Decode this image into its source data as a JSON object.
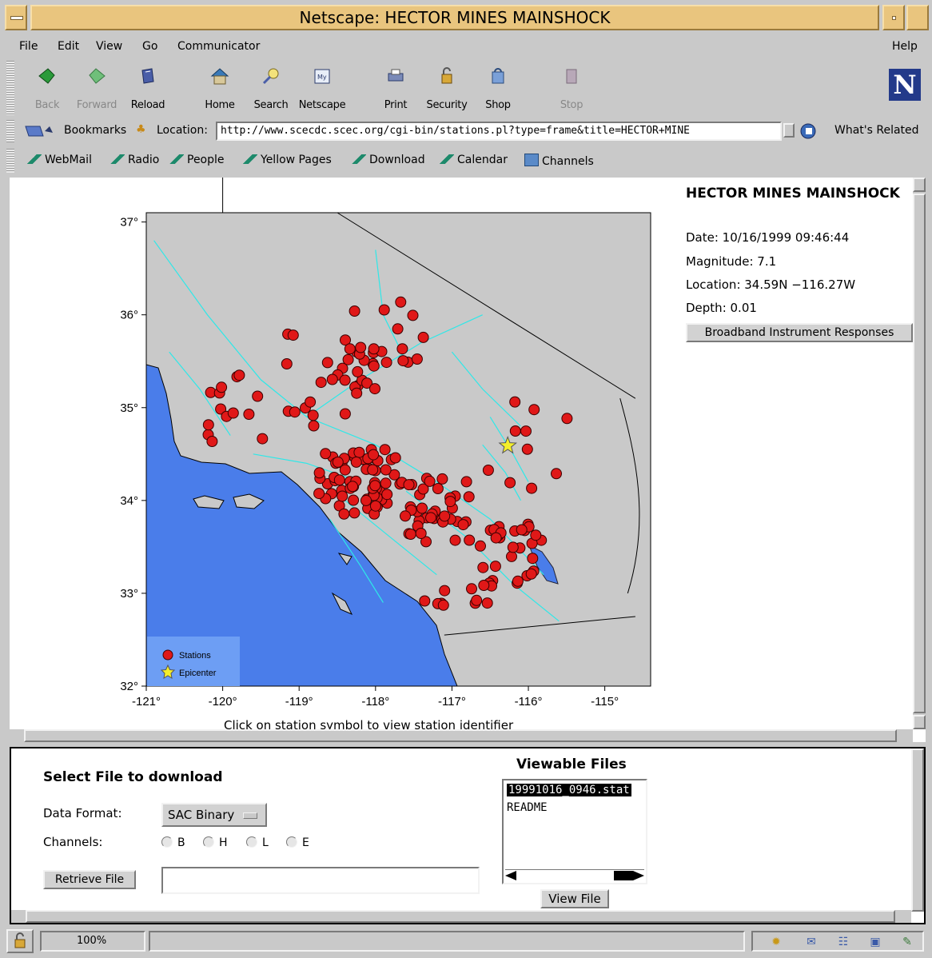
{
  "window": {
    "title": "Netscape: HECTOR MINES MAINSHOCK"
  },
  "menu": {
    "file": "File",
    "edit": "Edit",
    "view": "View",
    "go": "Go",
    "communicator": "Communicator",
    "help": "Help"
  },
  "toolbar": {
    "back": "Back",
    "forward": "Forward",
    "reload": "Reload",
    "home": "Home",
    "search": "Search",
    "netscape": "Netscape",
    "print": "Print",
    "security": "Security",
    "shop": "Shop",
    "stop": "Stop"
  },
  "locationbar": {
    "bookmarks": "Bookmarks",
    "location_label": "Location:",
    "url": "http://www.scecdc.scec.org/cgi-bin/stations.pl?type=frame&title=HECTOR+MINE",
    "whats_related": "What's Related"
  },
  "personal_toolbar": [
    "WebMail",
    "Radio",
    "People",
    "Yellow Pages",
    "Download",
    "Calendar",
    "Channels"
  ],
  "map": {
    "lat_ticks": [
      "37°",
      "36°",
      "35°",
      "34°",
      "33°",
      "32°"
    ],
    "lon_ticks": [
      "-121°",
      "-120°",
      "-119°",
      "-118°",
      "-117°",
      "-116°",
      "-115°"
    ],
    "legend_stations": "Stations",
    "legend_epicenter": "Epicenter",
    "caption": "Click on station symbol to view station identifier",
    "colors": {
      "ocean": "#4a7dea",
      "land": "#c9c9c9",
      "faults": "#2ee8e8",
      "station": "#e01818",
      "epicenter": "#f4ee2a"
    }
  },
  "quake": {
    "title": "HECTOR MINES MAINSHOCK",
    "date": "Date: 10/16/1999  09:46:44",
    "magnitude": "Magnitude: 7.1",
    "location": "Location: 34.59N   −116.27W",
    "depth": "Depth: 0.01",
    "instrument_button": "Broadband Instrument Responses"
  },
  "download_form": {
    "title": "Select File to download",
    "format_label": "Data Format:",
    "format_value": "SAC Binary",
    "channels_label": "Channels:",
    "channels": [
      "B",
      "H",
      "L",
      "E"
    ],
    "retrieve_button": "Retrieve File",
    "retrieve_value": ""
  },
  "viewable": {
    "title": "Viewable Files",
    "files": [
      "19991016_0946.stat",
      "README"
    ],
    "view_button": "View File"
  },
  "status": {
    "zoom": "100%"
  }
}
